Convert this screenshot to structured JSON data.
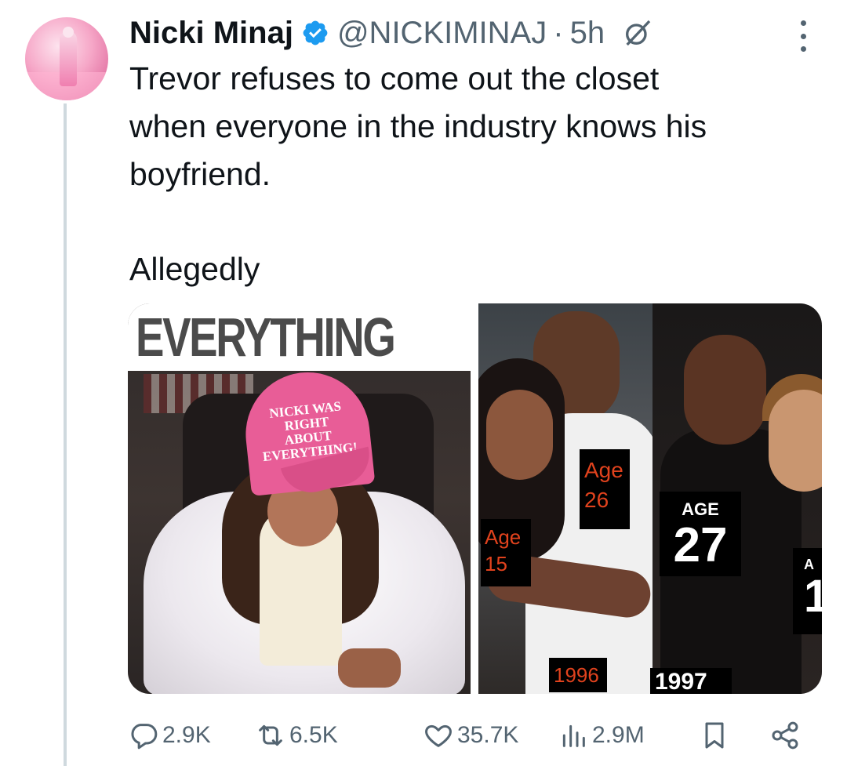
{
  "tweet": {
    "author": {
      "name": "Nicki Minaj",
      "handle": "@NICKIMINAJ",
      "verified": true,
      "verified_color": "#1d9bf0"
    },
    "separator": "·",
    "time": "5h",
    "text_lines": [
      "Trevor refuses to come out the closet",
      "when everyone in the industry knows his",
      "boyfriend."
    ],
    "text_2": "Allegedly",
    "media": {
      "left_image": {
        "headline": "EVERYTHING",
        "cap_text": [
          "NICKI WAS",
          "RIGHT ABOUT",
          "EVERYTHING!"
        ],
        "cap_color": "#e85d97"
      },
      "right_image": {
        "labels": {
          "age26_word": "Age",
          "age26_num": "26",
          "age15_word": "Age",
          "age15_num": "15",
          "age27_word": "AGE",
          "age27_num": "27",
          "edge_word": "A",
          "edge_num": "1",
          "year_1996": "1996",
          "year_1997": "1997"
        },
        "label_color": "#e0421d"
      }
    },
    "actions": {
      "replies": "2.9K",
      "reposts": "6.5K",
      "likes": "35.7K",
      "views": "2.9M"
    },
    "icons": {
      "grok": "grok-icon",
      "more": "more-options-icon",
      "reply": "reply-icon",
      "repost": "repost-icon",
      "like": "heart-icon",
      "views": "views-chart-icon",
      "bookmark": "bookmark-icon",
      "share": "share-icon"
    },
    "ui_color_secondary": "#536471"
  }
}
